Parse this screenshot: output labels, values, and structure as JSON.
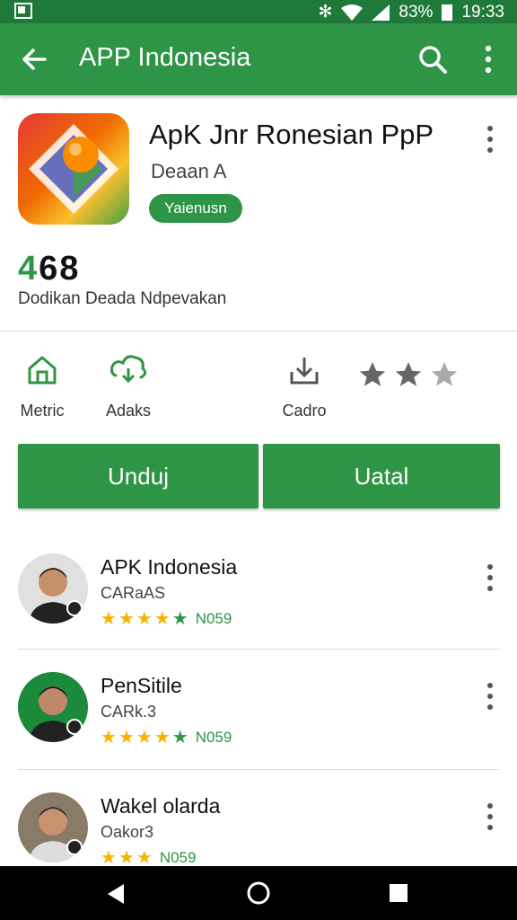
{
  "status_bar": {
    "battery": "83%",
    "time": "19:33"
  },
  "app_bar": {
    "title": "APP Indonesia"
  },
  "app": {
    "title": "ApK Jnr Ronesian PpP",
    "developer": "Deaan A",
    "badge": "Yaienusn",
    "count": "468",
    "subtitle": "Dodikan Deada Ndpevakan"
  },
  "stats": [
    {
      "label": "Metric",
      "icon": "home-icon"
    },
    {
      "label": "Adaks",
      "icon": "cloud-icon"
    },
    {
      "label": "Cadro",
      "icon": "download-icon"
    }
  ],
  "rating_stars": {
    "filled": 2,
    "total": 3
  },
  "buttons": {
    "primary": "Unduj",
    "secondary": "Uatal"
  },
  "developers": [
    {
      "name": "APK Indonesia",
      "sub": "CARaAS",
      "reviews": "N059"
    },
    {
      "name": "PenSitile",
      "sub": "CARk.3",
      "reviews": "N059"
    },
    {
      "name": "Wakel olarda",
      "sub": "Oakor3",
      "reviews": "N059"
    }
  ],
  "colors": {
    "accent": "#2e9446",
    "status": "#1f7a3a",
    "star": "#f4b400"
  }
}
